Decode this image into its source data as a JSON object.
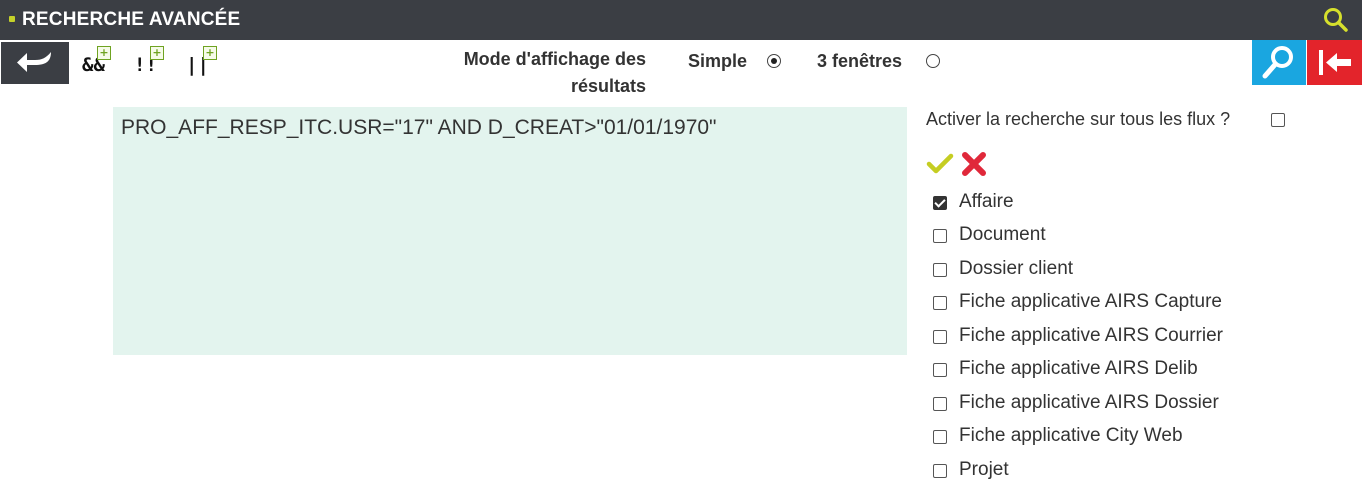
{
  "window": {
    "title": "RECHERCHE AVANCÉE",
    "title_icon": "search-icon",
    "colors": {
      "titlebar": "#3b3e44",
      "accent_yellow": "#c5d12a"
    }
  },
  "toolbar": {
    "back_icon": "back-arrow-icon",
    "operators": [
      {
        "label": "&&",
        "icon": "plus-icon"
      },
      {
        "label": "!!",
        "icon": "plus-icon"
      },
      {
        "label": "||",
        "icon": "plus-icon"
      }
    ],
    "display_mode": {
      "label_line1": "Mode d'affichage des",
      "label_line2": "résultats",
      "options": [
        {
          "label": "Simple",
          "selected": true
        },
        {
          "label": "3 fenêtres",
          "selected": false
        }
      ]
    },
    "search_button_icon": "magnifier-icon",
    "exit_button_icon": "exit-arrow-icon",
    "colors": {
      "search": "#1aa6e0",
      "exit": "#e3242b"
    }
  },
  "query": {
    "value": "PRO_AFF_RESP_ITC.USR=\"17\" AND D_CREAT>\"01/01/1970\"",
    "background": "#e3f4ee"
  },
  "flux_panel": {
    "all_flux_label": "Activer la recherche sur tous les flux ?",
    "all_flux_checked": false,
    "select_all_icon": "checkmark-icon",
    "deselect_all_icon": "cross-icon",
    "items": [
      {
        "label": "Affaire",
        "checked": true
      },
      {
        "label": "Document",
        "checked": false
      },
      {
        "label": "Dossier client",
        "checked": false
      },
      {
        "label": "Fiche applicative AIRS Capture",
        "checked": false
      },
      {
        "label": "Fiche applicative AIRS Courrier",
        "checked": false
      },
      {
        "label": "Fiche applicative AIRS Delib",
        "checked": false
      },
      {
        "label": "Fiche applicative AIRS Dossier",
        "checked": false
      },
      {
        "label": "Fiche applicative City Web",
        "checked": false
      },
      {
        "label": "Projet",
        "checked": false
      }
    ]
  }
}
